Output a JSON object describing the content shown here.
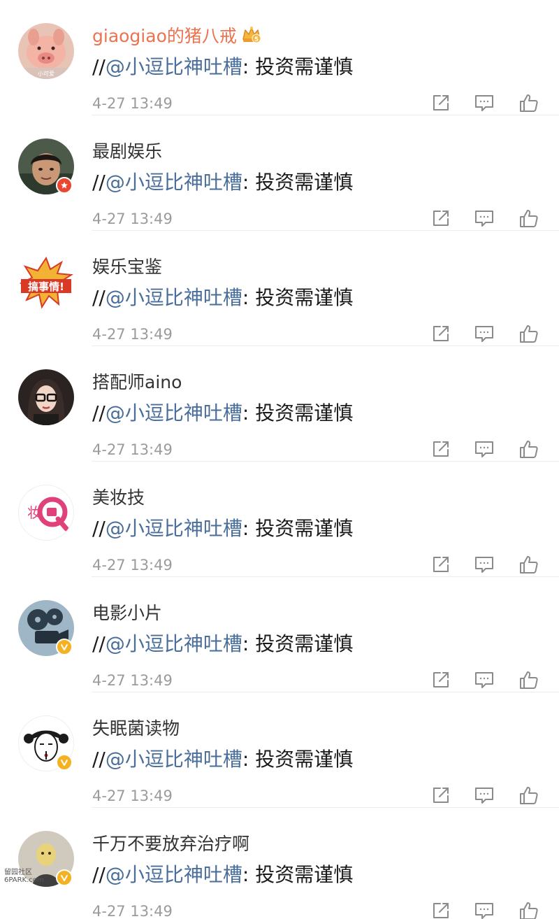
{
  "mention_prefix": "//",
  "colors": {
    "mention": "#4a6e9a",
    "member_name": "#eb7350",
    "meta": "#9b9b9b",
    "verified_badge": "#f4b222",
    "red_badge": "#e9472f"
  },
  "icons": {
    "share": "share-icon",
    "comment": "comment-icon",
    "like": "thumbs-up-icon",
    "member": "crown-icon"
  },
  "reposts": [
    {
      "username": "giaogiao的猪八戒",
      "mention": "@小逗比神吐槽",
      "text": ": 投资需谨慎",
      "time": "4-27 13:49",
      "avatar_caption": "小可爱"
    },
    {
      "username": "最剧娱乐",
      "mention": "@小逗比神吐槽",
      "text": ": 投资需谨慎",
      "time": "4-27 13:49"
    },
    {
      "username": "娱乐宝鉴",
      "mention": "@小逗比神吐槽",
      "text": ": 投资需谨慎",
      "time": "4-27 13:49",
      "avatar_caption": "搞事情!"
    },
    {
      "username": "搭配师aino",
      "mention": "@小逗比神吐槽",
      "text": ": 投资需谨慎",
      "time": "4-27 13:49"
    },
    {
      "username": "美妆技",
      "mention": "@小逗比神吐槽",
      "text": ": 投资需谨慎",
      "time": "4-27 13:49",
      "avatar_caption": "妆"
    },
    {
      "username": "电影小片",
      "mention": "@小逗比神吐槽",
      "text": ": 投资需谨慎",
      "time": "4-27 13:49"
    },
    {
      "username": "失眠菌读物",
      "mention": "@小逗比神吐槽",
      "text": ": 投资需谨慎",
      "time": "4-27 13:49"
    },
    {
      "username": "千万不要放弃治疗啊",
      "mention": "@小逗比神吐槽",
      "text": ": 投资需谨慎",
      "time": "4-27 13:49"
    }
  ],
  "member_level": "5",
  "watermark": "留园社区 6PARK.com"
}
